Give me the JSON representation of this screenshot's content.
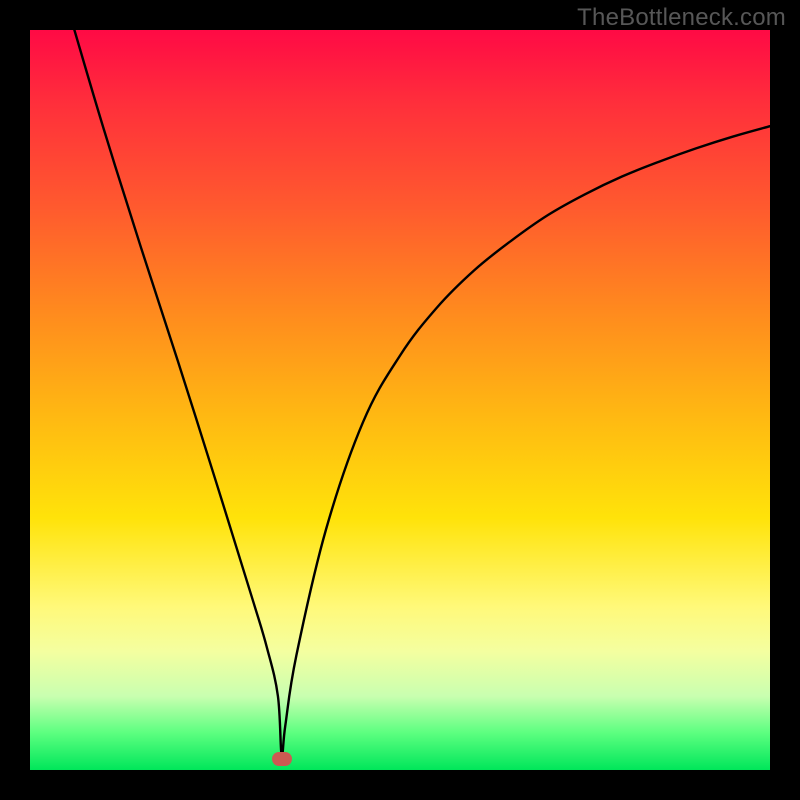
{
  "watermark": "TheBottleneck.com",
  "chart_data": {
    "type": "line",
    "title": "",
    "xlabel": "",
    "ylabel": "",
    "xlim": [
      0,
      100
    ],
    "ylim": [
      0,
      100
    ],
    "grid": false,
    "legend": false,
    "series": [
      {
        "name": "curve",
        "x": [
          6,
          10,
          15,
          20,
          25,
          30,
          32,
          33.5,
          34,
          34.5,
          36,
          40,
          45,
          50,
          55,
          60,
          65,
          70,
          75,
          80,
          85,
          90,
          95,
          100
        ],
        "y": [
          100,
          86.5,
          70.6,
          55.2,
          39.4,
          23.3,
          16.6,
          10,
          2,
          6,
          15.5,
          32.5,
          47,
          56,
          62.5,
          67.5,
          71.5,
          75,
          77.8,
          80.2,
          82.2,
          84,
          85.6,
          87
        ]
      }
    ],
    "marker": {
      "x": 34,
      "y": 1.5,
      "color": "#cc5a52"
    },
    "gradient_stops": [
      {
        "pos": 0,
        "color": "#ff0a45"
      },
      {
        "pos": 10,
        "color": "#ff2f3b"
      },
      {
        "pos": 24,
        "color": "#ff5a2e"
      },
      {
        "pos": 38,
        "color": "#ff8a1e"
      },
      {
        "pos": 52,
        "color": "#ffb812"
      },
      {
        "pos": 66,
        "color": "#ffe30a"
      },
      {
        "pos": 78,
        "color": "#fff97a"
      },
      {
        "pos": 84,
        "color": "#f4ffa0"
      },
      {
        "pos": 90,
        "color": "#c9ffb0"
      },
      {
        "pos": 95,
        "color": "#5cff80"
      },
      {
        "pos": 100,
        "color": "#00e65a"
      }
    ]
  }
}
